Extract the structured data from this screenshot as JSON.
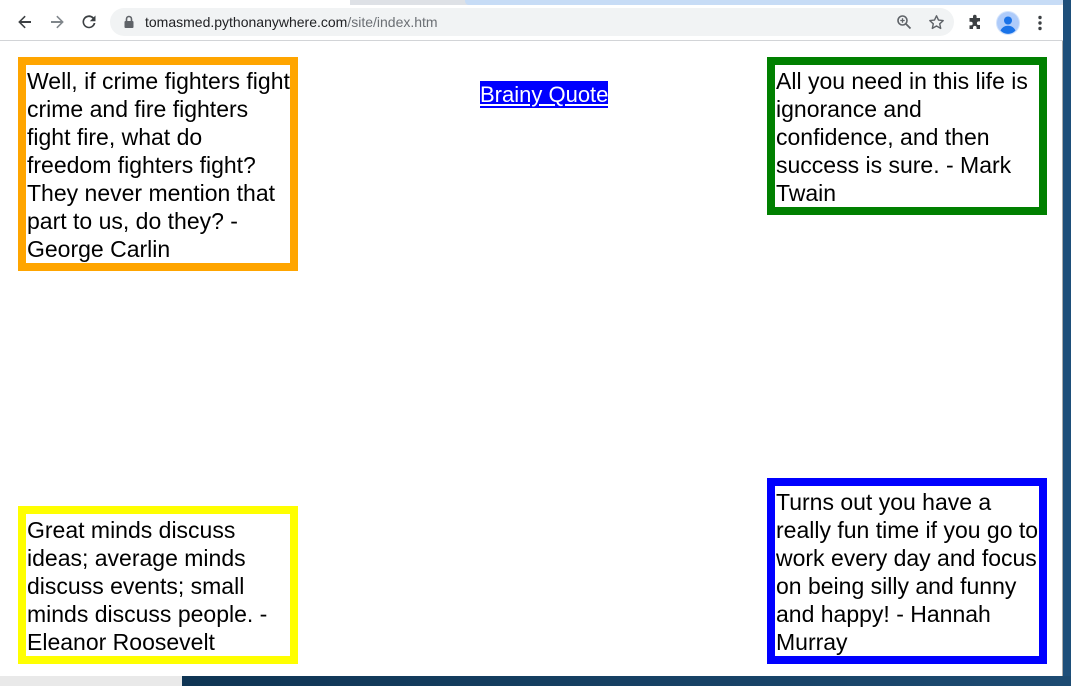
{
  "browser": {
    "url_host": "tomasmed.pythonanywhere.com",
    "url_path": "/site/index.htm"
  },
  "page": {
    "link_label": "Brainy Quote",
    "quotes": {
      "top_left": "Well, if crime fighters fight crime and fire fighters fight fire, what do freedom fighters fight? They never mention that part to us, do they? - George Carlin",
      "top_right": "All you need in this life is ignorance and confidence, and then success is sure. - Mark Twain",
      "bottom_left": "Great minds discuss ideas; average minds discuss events; small minds discuss people. - Eleanor Roosevelt",
      "bottom_right": "Turns out you have a really fun time if you go to work every day and focus on being silly and funny and happy! - Hannah Murray"
    }
  },
  "colors": {
    "top_left_border": "#ffa500",
    "top_right_border": "#008000",
    "bottom_left_border": "#ffff00",
    "bottom_right_border": "#0000ff",
    "link_background": "#0000ff",
    "link_text": "#ffffff"
  },
  "icons": {
    "back": "arrow-left-icon",
    "forward": "arrow-right-icon",
    "reload": "reload-icon",
    "lock": "lock-icon",
    "zoom": "zoom-icon",
    "bookmark": "star-icon",
    "extensions": "puzzle-icon",
    "profile": "profile-icon",
    "menu": "kebab-menu-icon"
  }
}
